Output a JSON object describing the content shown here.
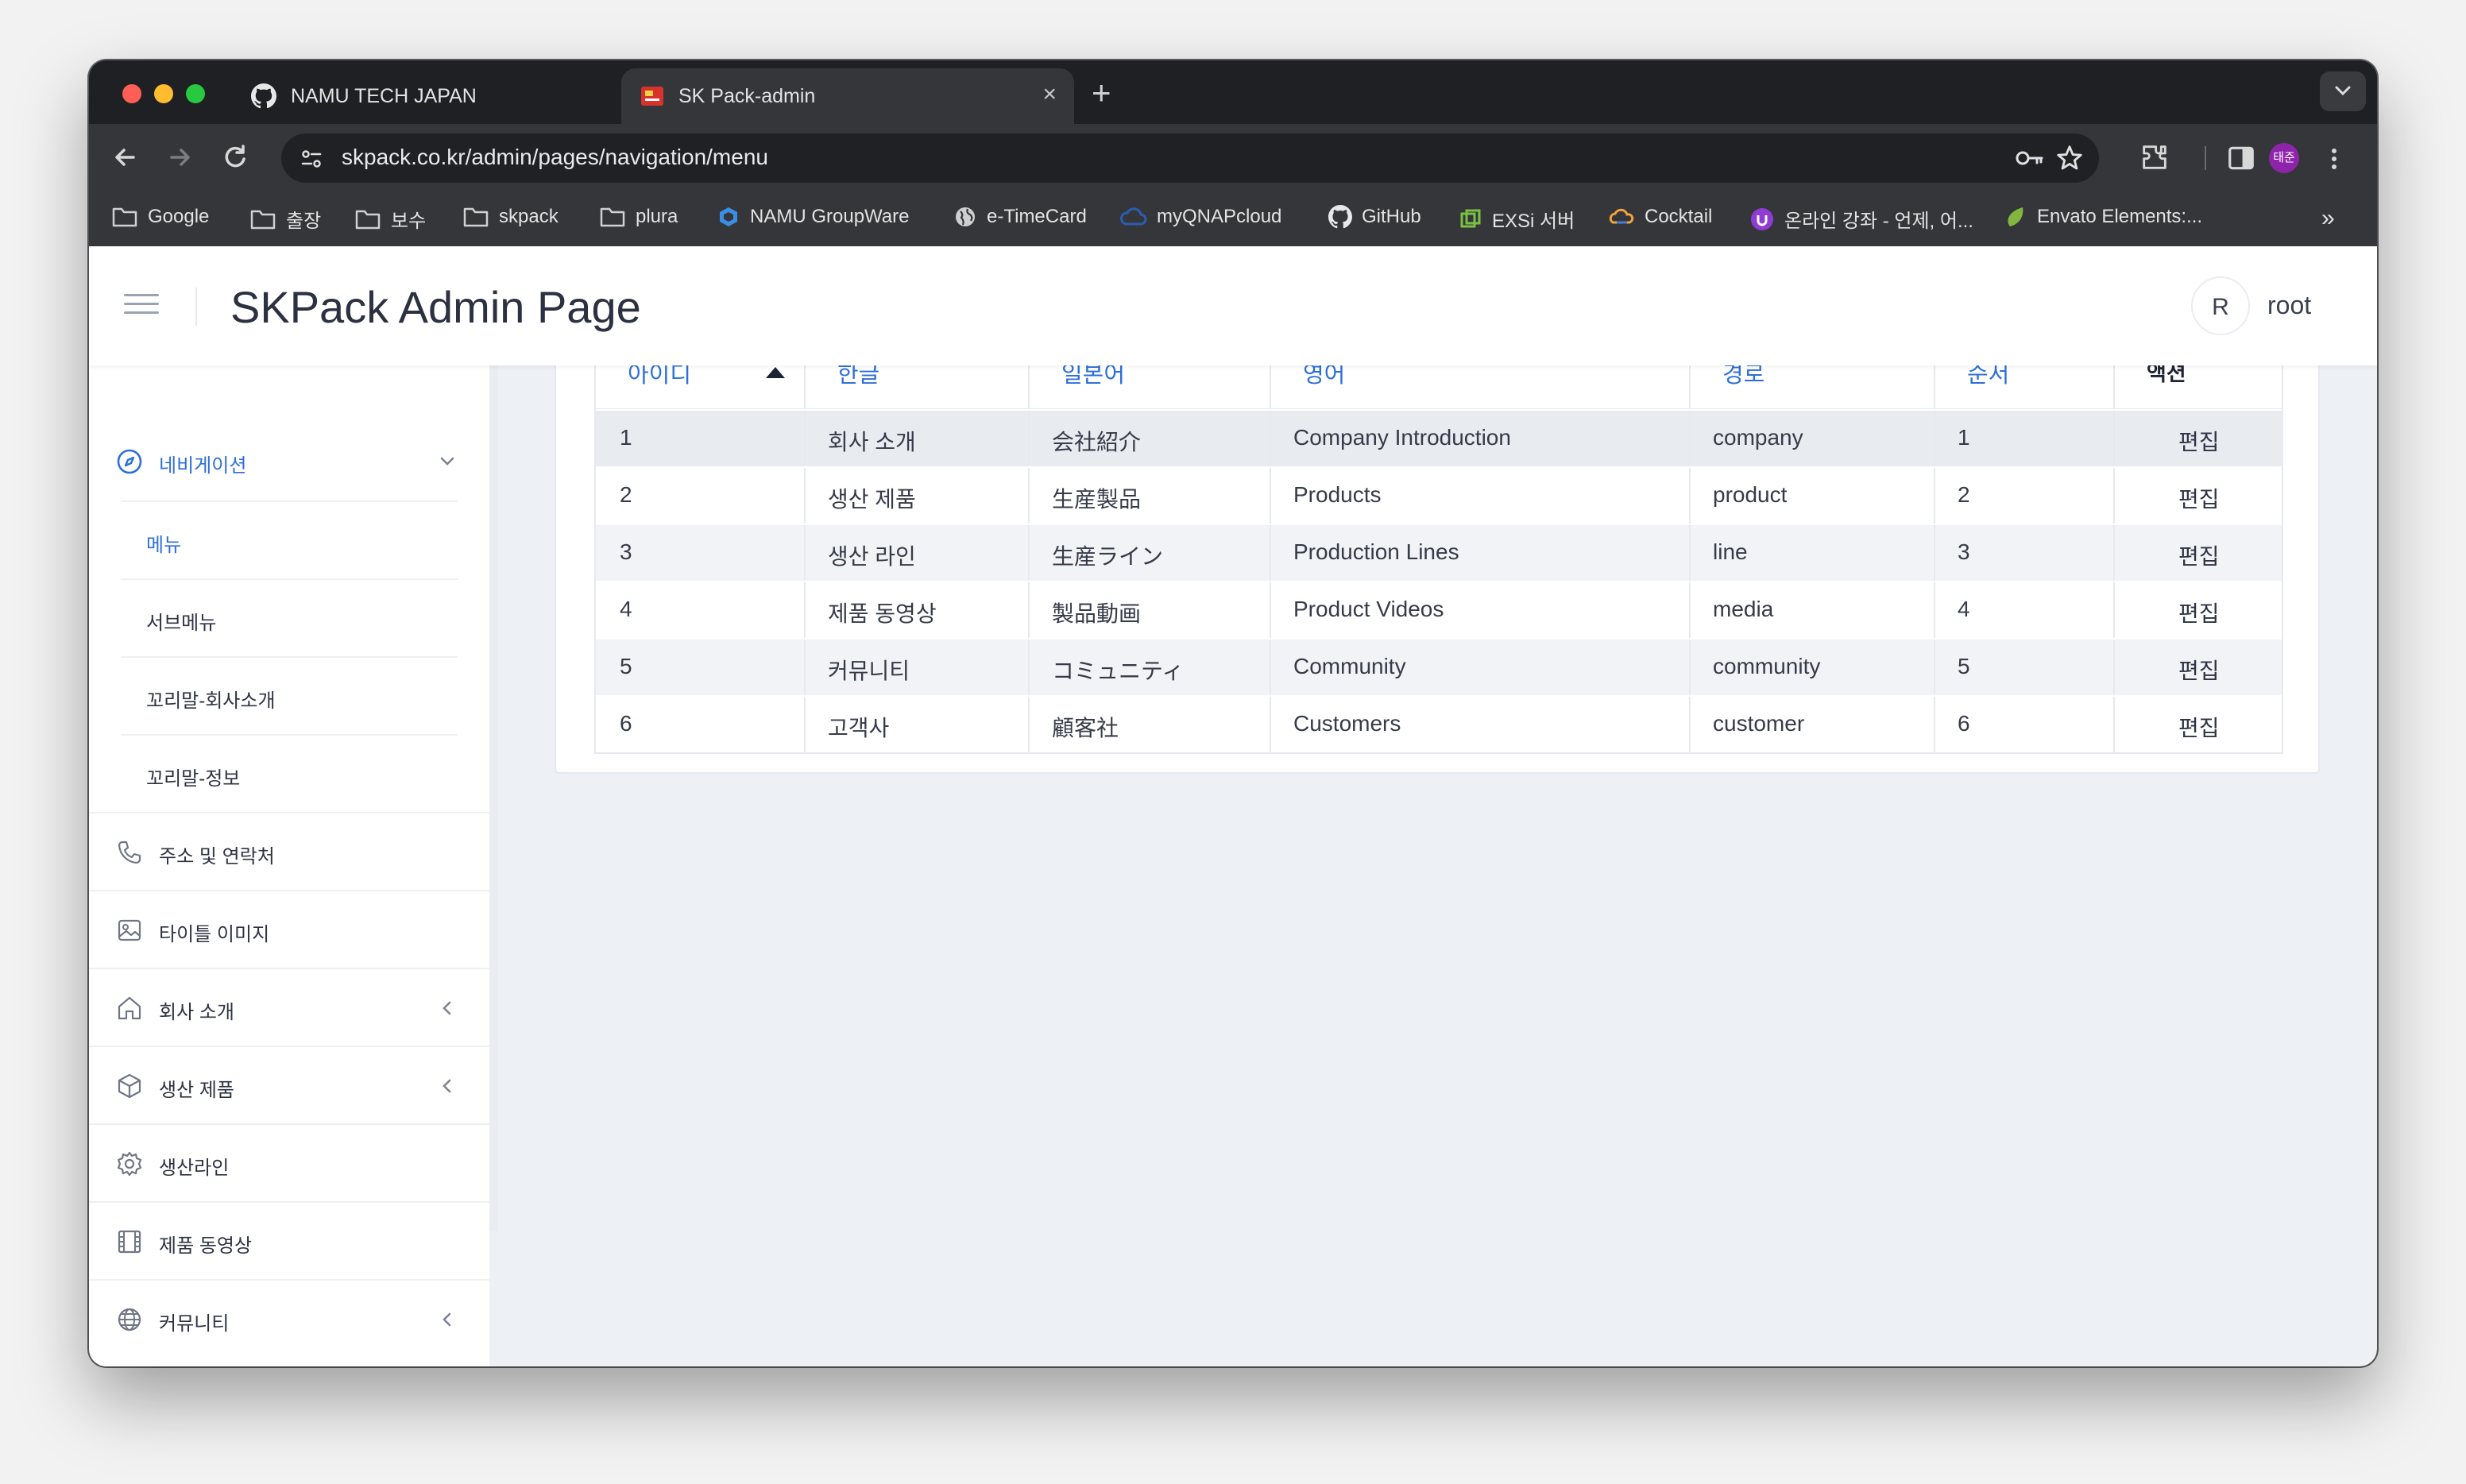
{
  "browser": {
    "tabs": [
      {
        "title": "NAMU TECH JAPAN",
        "icon": "github-icon"
      },
      {
        "title": "SK Pack-admin",
        "icon": "skpack-favicon-icon",
        "active": true
      }
    ],
    "url": "skpack.co.kr/admin/pages/navigation/menu",
    "profile_initials": "태준",
    "bookmarks": [
      {
        "label": "Google",
        "icon": "folder-icon"
      },
      {
        "label": "출장",
        "icon": "folder-icon"
      },
      {
        "label": "보수",
        "icon": "folder-icon"
      },
      {
        "label": "skpack",
        "icon": "folder-icon"
      },
      {
        "label": "plura",
        "icon": "folder-icon"
      },
      {
        "label": "NAMU GroupWare",
        "icon": "namu-icon"
      },
      {
        "label": "e-TimeCard",
        "icon": "globe-icon"
      },
      {
        "label": "myQNAPcloud",
        "icon": "cloud-icon"
      },
      {
        "label": "GitHub",
        "icon": "github-icon"
      },
      {
        "label": "EXSi 서버",
        "icon": "vmware-icon"
      },
      {
        "label": "Cocktail",
        "icon": "cocktail-icon"
      },
      {
        "label": "온라인 강좌 - 언제, 어...",
        "icon": "udemy-icon"
      },
      {
        "label": "Envato Elements:...",
        "icon": "envato-icon"
      }
    ]
  },
  "header": {
    "title": "SKPack Admin Page",
    "avatar_initial": "R",
    "user_name": "root"
  },
  "sidebar": {
    "navigation": {
      "label": "네비게이션",
      "expanded": true
    },
    "sub_items": [
      {
        "label": "메뉴",
        "active": true
      },
      {
        "label": "서브메뉴"
      },
      {
        "label": "꼬리말-회사소개"
      },
      {
        "label": "꼬리말-정보"
      }
    ],
    "items": [
      {
        "label": "주소 및 연락처",
        "icon": "phone-icon"
      },
      {
        "label": "타이틀 이미지",
        "icon": "image-icon"
      },
      {
        "label": "회사 소개",
        "icon": "home-icon",
        "has_children": true
      },
      {
        "label": "생산 제품",
        "icon": "cube-icon",
        "has_children": true
      },
      {
        "label": "생산라인",
        "icon": "gear-icon"
      },
      {
        "label": "제품 동영상",
        "icon": "film-icon"
      },
      {
        "label": "커뮤니티",
        "icon": "globe-icon",
        "has_children": true
      }
    ]
  },
  "table": {
    "columns": [
      "아이디",
      "한글",
      "일본어",
      "영어",
      "경로",
      "순서",
      "액션"
    ],
    "sort": {
      "column": "아이디",
      "direction": "asc"
    },
    "rows": [
      {
        "id": "1",
        "ko": "회사 소개",
        "ja": "会社紹介",
        "en": "Company Introduction",
        "path": "company",
        "order": "1",
        "action": "편집"
      },
      {
        "id": "2",
        "ko": "생산 제품",
        "ja": "生産製品",
        "en": "Products",
        "path": "product",
        "order": "2",
        "action": "편집"
      },
      {
        "id": "3",
        "ko": "생산 라인",
        "ja": "生産ライン",
        "en": "Production Lines",
        "path": "line",
        "order": "3",
        "action": "편집"
      },
      {
        "id": "4",
        "ko": "제품 동영상",
        "ja": "製品動画",
        "en": "Product Videos",
        "path": "media",
        "order": "4",
        "action": "편집"
      },
      {
        "id": "5",
        "ko": "커뮤니티",
        "ja": "コミュニティ",
        "en": "Community",
        "path": "community",
        "order": "5",
        "action": "편집"
      },
      {
        "id": "6",
        "ko": "고객사",
        "ja": "顧客社",
        "en": "Customers",
        "path": "customer",
        "order": "6",
        "action": "편집"
      }
    ]
  },
  "colors": {
    "accent": "#2d6fd8",
    "page_bg": "#edf0f5",
    "text_dark": "#2d3342"
  }
}
